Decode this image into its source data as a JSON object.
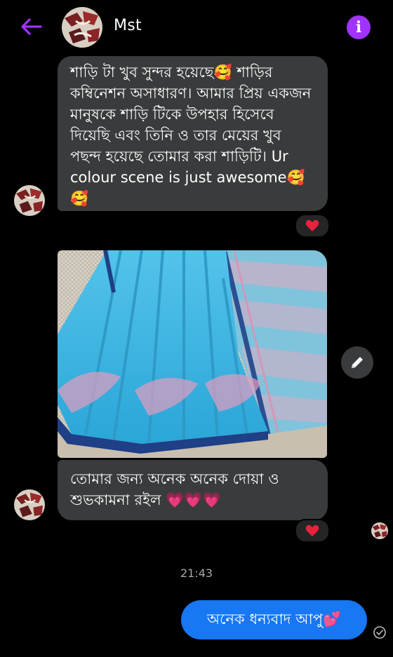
{
  "header": {
    "contact_name": "Mst"
  },
  "messages": [
    {
      "from": "them",
      "text": "শাড়ি টা খুব সুন্দর হয়েছে🥰 শাড়ির কম্বিনেশন অসাধারণ। আমার প্রিয় একজন মানুষকে শাড়ি টিকে উপহার হিসেবে দিয়েছি এবং তিনি ও তার মেয়ের খুব পছন্দ হয়েছে তোমার করা শাড়িটি। Ur colour scene is just awesome🥰🥰",
      "reaction": "heart"
    },
    {
      "from": "them",
      "type": "image",
      "description": "sky blue saree photo"
    },
    {
      "from": "them",
      "text": "তোমার জন্য অনেক অনেক দোয়া ও শুভকামনা রইল 💗💗💗",
      "reaction": "heart"
    }
  ],
  "timestamp": "21:43",
  "outgoing": {
    "text": "অনেক ধন্যবাদ আপু💕"
  },
  "colors": {
    "accent": "#a033ff",
    "outgoing_bubble": "#1877f2",
    "incoming_bubble": "#3a3b3c",
    "reaction_heart": "#e8223b"
  }
}
